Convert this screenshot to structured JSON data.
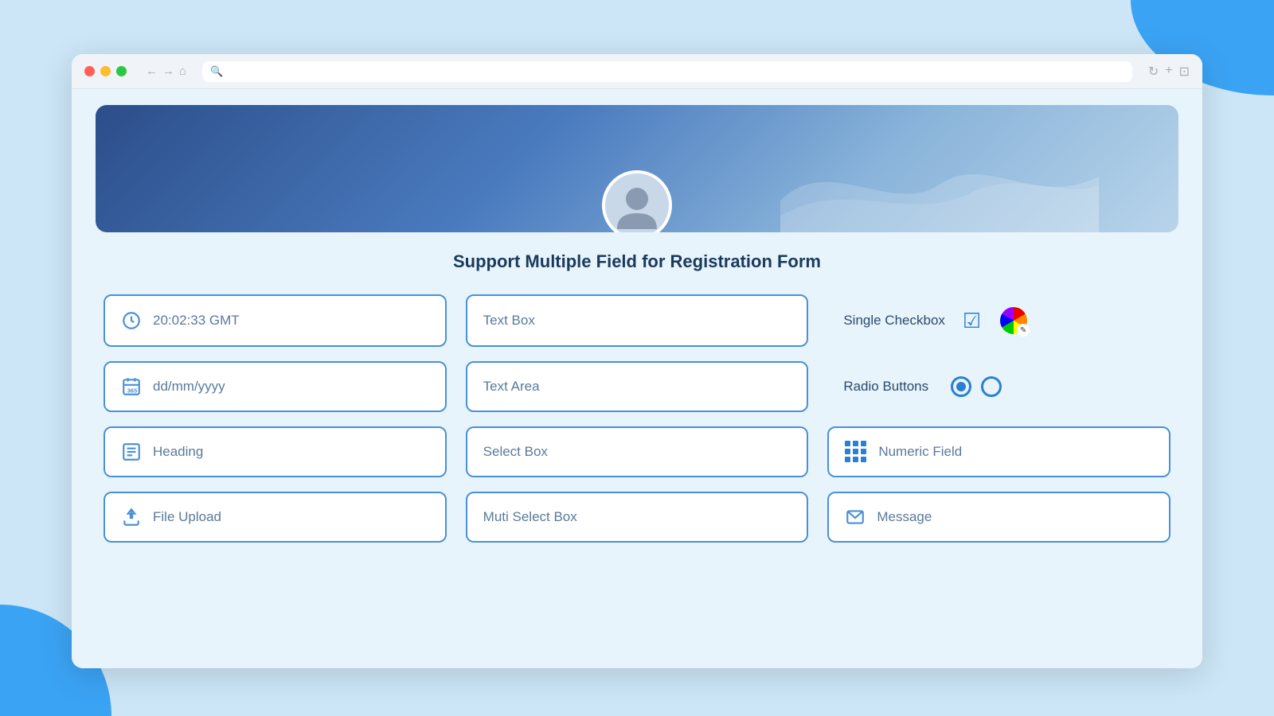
{
  "page": {
    "background_color": "#cce6f7",
    "accent_color": "#2196f3"
  },
  "browser": {
    "traffic_lights": [
      "red",
      "yellow",
      "green"
    ],
    "address_bar_placeholder": "🔍"
  },
  "banner": {
    "avatar_alt": "User profile avatar"
  },
  "title": "Support Multiple Field for Registration Form",
  "fields": {
    "column1": [
      {
        "id": "time",
        "label": "20:02:33 GMT",
        "icon": "clock"
      },
      {
        "id": "date",
        "label": "dd/mm/yyyy",
        "icon": "calendar"
      },
      {
        "id": "heading",
        "label": "Heading",
        "icon": "heading"
      },
      {
        "id": "file-upload",
        "label": "File Upload",
        "icon": "upload"
      }
    ],
    "column2": [
      {
        "id": "text-box",
        "label": "Text Box",
        "icon": "none"
      },
      {
        "id": "text-area",
        "label": "Text Area",
        "icon": "none"
      },
      {
        "id": "select-box",
        "label": "Select Box",
        "icon": "none"
      },
      {
        "id": "multi-select",
        "label": "Muti Select Box",
        "icon": "none"
      }
    ],
    "column3": [
      {
        "id": "checkbox",
        "label": "Single Checkbox",
        "icon": "checkbox"
      },
      {
        "id": "radio",
        "label": "Radio Buttons",
        "icon": "radio"
      },
      {
        "id": "numeric",
        "label": "Numeric Field",
        "icon": "dots"
      },
      {
        "id": "message",
        "label": "Message",
        "icon": "envelope"
      }
    ]
  }
}
